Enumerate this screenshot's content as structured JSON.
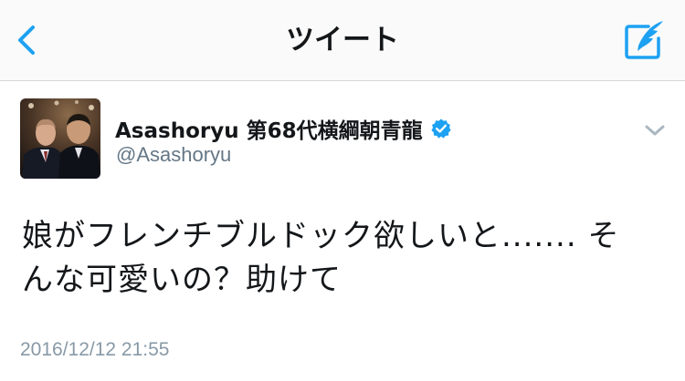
{
  "nav": {
    "title": "ツイート",
    "back_icon": "chevron-left-icon",
    "compose_icon": "compose-tweet-icon"
  },
  "tweet": {
    "author": {
      "display_name": "Asashoryu 第68代横綱朝青龍",
      "handle": "@Asashoryu",
      "verified": true
    },
    "text_line1": "娘がフレンチブルドック欲しいと....... そ",
    "text_line2": "んな可愛いの？助けて",
    "timestamp": "2016/12/12 21:55"
  },
  "colors": {
    "accent": "#1da1f2",
    "text": "#14171a",
    "secondary": "#657786",
    "timestamp": "#8899a6",
    "nav_background": "#fafafa"
  }
}
